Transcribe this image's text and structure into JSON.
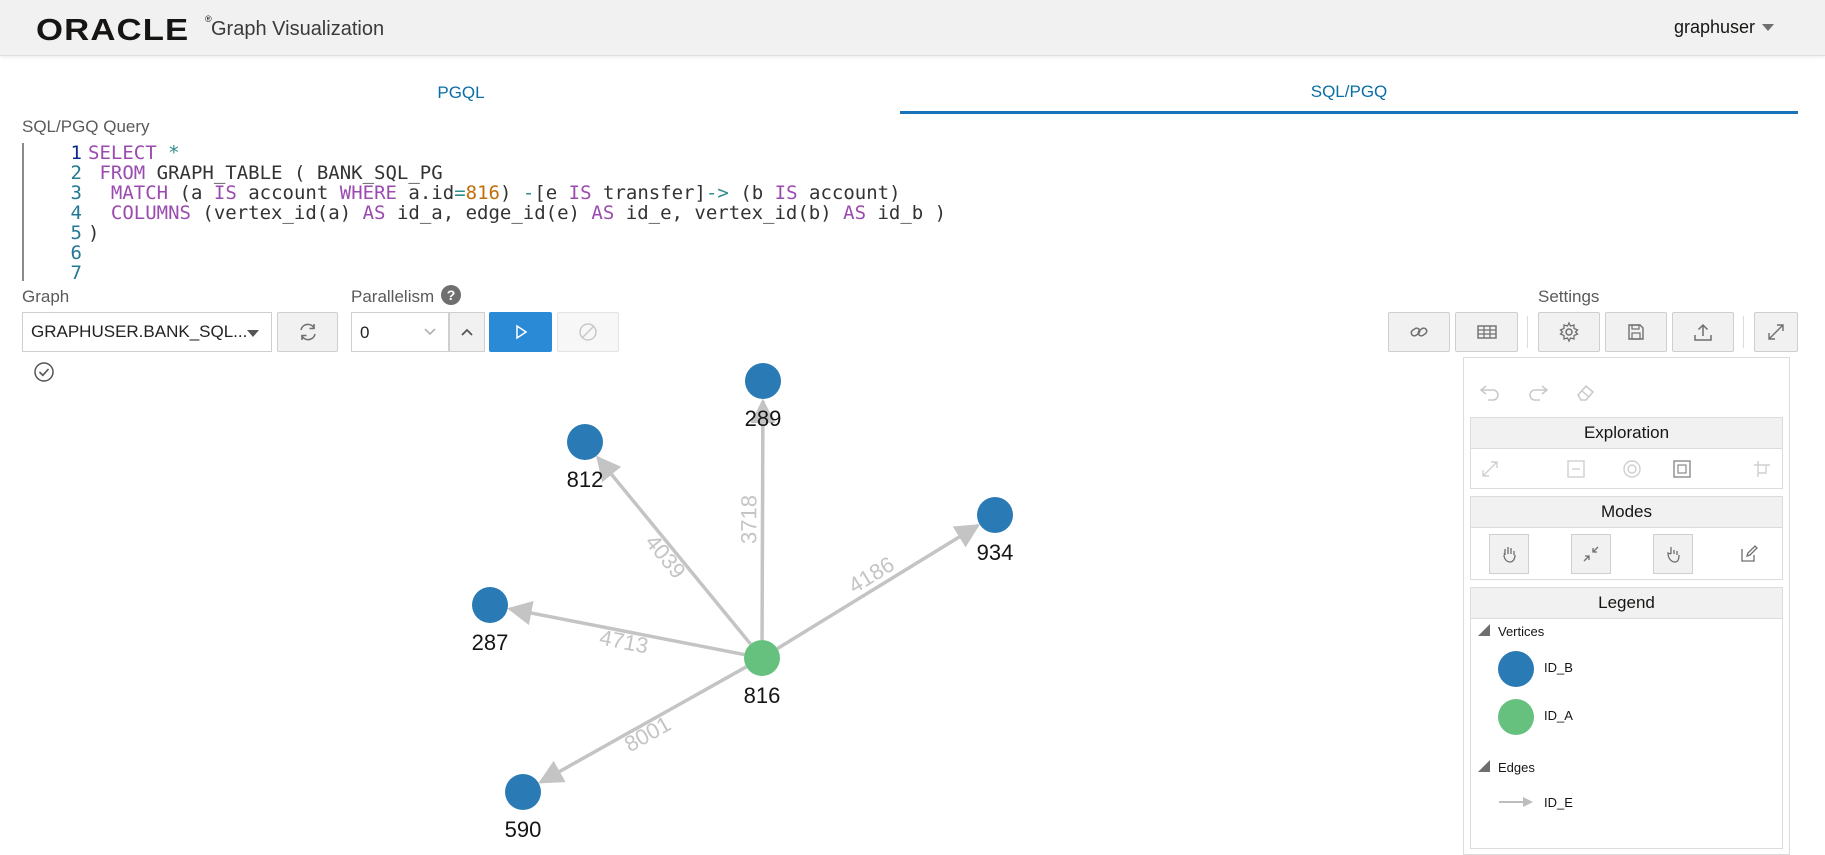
{
  "header": {
    "logo": "ORACLE",
    "reg": "®",
    "app_title": "Graph Visualization",
    "user": "graphuser"
  },
  "tabs": [
    {
      "label": "PGQL",
      "active": false
    },
    {
      "label": "SQL/PGQ",
      "active": true
    }
  ],
  "query": {
    "label": "SQL/PGQ Query",
    "line_numbers": [
      "1",
      "2",
      "3",
      "4",
      "5",
      "6",
      "7"
    ]
  },
  "controls": {
    "graph_label": "Graph",
    "graph_value": "GRAPHUSER.BANK_SQL...",
    "parallelism_label": "Parallelism",
    "parallelism_value": "0",
    "help": "?",
    "settings_label": "Settings"
  },
  "graph": {
    "center": {
      "id": "816",
      "type": "ID_A",
      "color": "#66c17f"
    },
    "neighbors": [
      {
        "id": "289",
        "edge": "3718",
        "color": "#2a7ab5"
      },
      {
        "id": "812",
        "edge": "4039",
        "color": "#2a7ab5"
      },
      {
        "id": "934",
        "edge": "4186",
        "color": "#2a7ab5"
      },
      {
        "id": "287",
        "edge": "4713",
        "color": "#2a7ab5"
      },
      {
        "id": "590",
        "edge": "8001",
        "color": "#2a7ab5"
      }
    ]
  },
  "panel": {
    "exploration": "Exploration",
    "modes": "Modes",
    "legend": "Legend",
    "vertices": "Vertices",
    "edges": "Edges",
    "legend_items": {
      "id_b": "ID_B",
      "id_a": "ID_A",
      "id_e": "ID_E"
    }
  },
  "colors": {
    "vertex_b": "#2a7ab5",
    "vertex_a": "#66c17f",
    "edge": "#c4c4c4",
    "accent": "#1a73b8"
  }
}
